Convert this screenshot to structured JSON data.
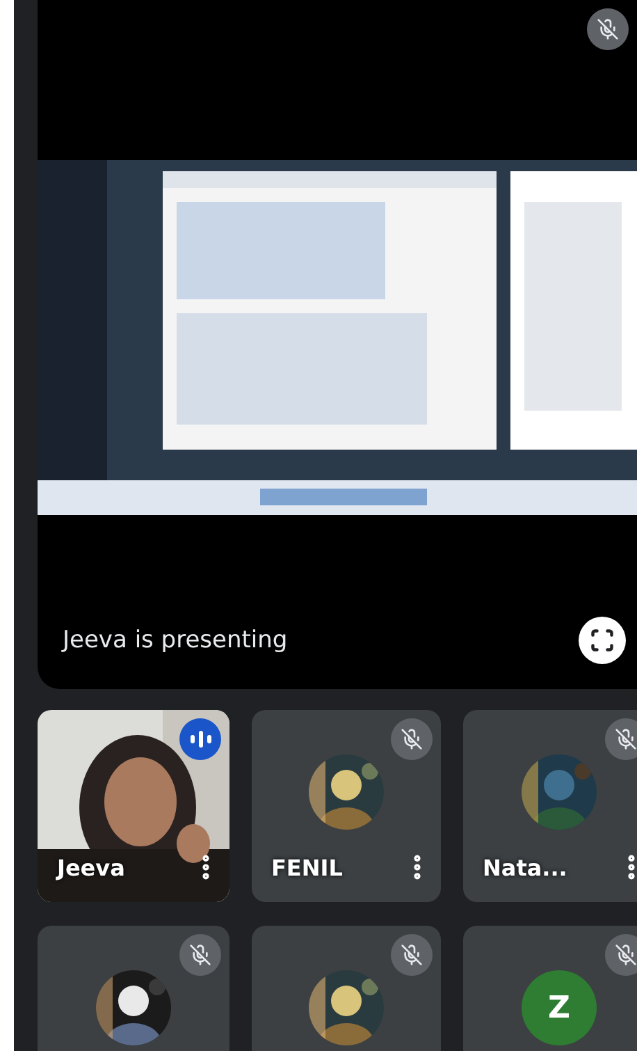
{
  "presentation": {
    "caption": "Jeeva is presenting",
    "muted": true
  },
  "participants": [
    {
      "name": "Jeeva",
      "kind": "video",
      "muted": false,
      "speaking": true
    },
    {
      "name": "FENIL",
      "kind": "avatar",
      "muted": true,
      "speaking": false
    },
    {
      "name": "Nata...",
      "kind": "avatar",
      "muted": true,
      "speaking": false
    },
    {
      "kind": "avatar",
      "muted": true,
      "speaking": false
    },
    {
      "kind": "avatar",
      "muted": true,
      "speaking": false
    },
    {
      "kind": "letter",
      "initial": "Z",
      "color": "#2e7d32",
      "muted": true,
      "speaking": false
    }
  ]
}
